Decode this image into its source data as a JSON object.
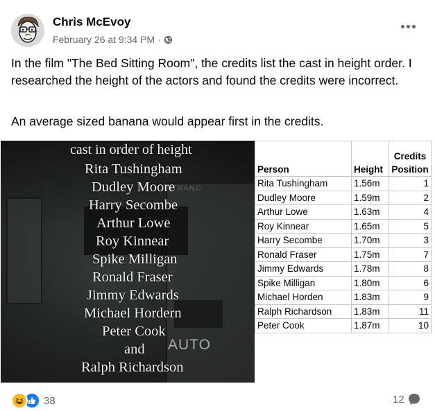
{
  "post": {
    "author": "Chris McEvoy",
    "timestamp": "February 26 at 9:34 PM",
    "separator": "·",
    "paragraph1": "In the film \"The Bed Sitting Room\", the credits list the cast in height order. I researched the height of the actors and found the credits were incorrect.",
    "paragraph2": "An average sized banana would appear first in the credits.",
    "more_icon": "more-options-icon",
    "privacy_icon": "globe-icon"
  },
  "film_still": {
    "lines": [
      "cast in order of height",
      "Rita Tushingham",
      "Dudley Moore",
      "Harry Secombe",
      "Arthur Lowe",
      "Roy Kinnear",
      "Spike Milligan",
      "Ronald Fraser",
      "Jimmy Edwards",
      "Michael Hordern",
      "Peter Cook",
      "and",
      "Ralph Richardson"
    ],
    "auto_sign": "AUTO",
    "background_sign": "NTRANC"
  },
  "height_table": {
    "headers": {
      "person": "Person",
      "height": "Height",
      "credits_1": "Credits",
      "credits_2": "Position"
    },
    "rows": [
      {
        "person": "Rita Tushingham",
        "height": "1.56m",
        "position": "1"
      },
      {
        "person": "Dudley Moore",
        "height": "1.59m",
        "position": "2"
      },
      {
        "person": "Arthur Lowe",
        "height": "1.63m",
        "position": "4"
      },
      {
        "person": "Roy Kinnear",
        "height": "1.65m",
        "position": "5"
      },
      {
        "person": "Harry Secombe",
        "height": "1.70m",
        "position": "3"
      },
      {
        "person": "Ronald Fraser",
        "height": "1.75m",
        "position": "7"
      },
      {
        "person": "Jimmy Edwards",
        "height": "1.78m",
        "position": "8"
      },
      {
        "person": "Spike Milligan",
        "height": "1.80m",
        "position": "6"
      },
      {
        "person": "Michael Horden",
        "height": "1.83m",
        "position": "9"
      },
      {
        "person": "Ralph Richardson",
        "height": "1.83m",
        "position": "11"
      },
      {
        "person": "Peter Cook",
        "height": "1.87m",
        "position": "10"
      }
    ]
  },
  "footer": {
    "reaction_count": "38",
    "comment_count": "12",
    "reaction_icons": [
      "haha-reaction-icon",
      "like-reaction-icon"
    ],
    "comment_icon": "comment-bubble-icon"
  },
  "colors": {
    "like_blue": "#1877f2",
    "haha_yellow": "#f7b928",
    "secondary_text": "#65676b"
  }
}
